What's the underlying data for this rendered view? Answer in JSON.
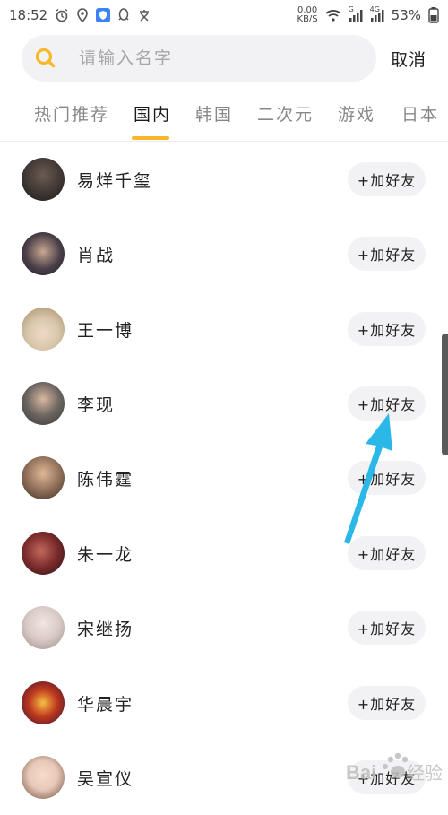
{
  "status_bar": {
    "time": "18:52",
    "net_speed_value": "0.00",
    "net_speed_unit": "KB/S",
    "signal_label_1": "G",
    "signal_label_2": "4G",
    "battery": "53%",
    "icons": [
      "alarm-icon",
      "location-icon",
      "shield-app-icon",
      "qq-icon",
      "text-app-icon",
      "wifi-icon",
      "signal-icon",
      "battery-icon"
    ]
  },
  "search": {
    "placeholder": "请输入名字",
    "cancel_label": "取消"
  },
  "tabs": [
    {
      "label": "热门推荐",
      "active": false
    },
    {
      "label": "国内",
      "active": true
    },
    {
      "label": "韩国",
      "active": false
    },
    {
      "label": "二次元",
      "active": false
    },
    {
      "label": "游戏",
      "active": false
    },
    {
      "label": "日本",
      "active": false
    }
  ],
  "colors": {
    "accent": "#f5b829",
    "annotation_arrow": "#2bb8e8"
  },
  "add_label": "+加好友",
  "contacts": [
    {
      "name": "易烊千玺",
      "avatar_color": "#3a3330"
    },
    {
      "name": "肖战",
      "avatar_color": "#2d2a33"
    },
    {
      "name": "王一博",
      "avatar_color": "#d9c7ad"
    },
    {
      "name": "李现",
      "avatar_color": "#6b6460"
    },
    {
      "name": "陈伟霆",
      "avatar_color": "#8a6a55"
    },
    {
      "name": "朱一龙",
      "avatar_color": "#7a2b2b"
    },
    {
      "name": "宋继扬",
      "avatar_color": "#d8c9c4"
    },
    {
      "name": "华晨宇",
      "avatar_color": "#c03a1f"
    },
    {
      "name": "吴宣仪",
      "avatar_color": "#e8c9b8"
    }
  ],
  "watermark": "Baidu 经验"
}
